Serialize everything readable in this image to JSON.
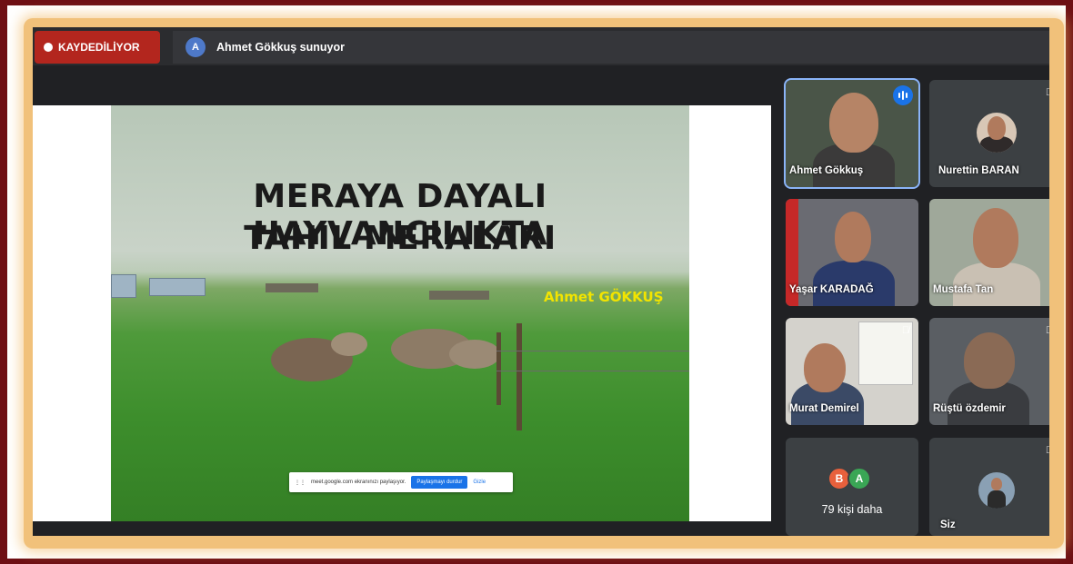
{
  "recording": {
    "label": "KAYDEDİLİYOR"
  },
  "presenter": {
    "avatar_letter": "A",
    "text": "Ahmet Gökkuş sunuyor"
  },
  "slide": {
    "title_line1": "MERAYA DAYALI HAYVANCILIKTA",
    "title_line2": "TAHIL MERALARI",
    "author": "Ahmet GÖKKUŞ"
  },
  "share_bar": {
    "message": "meet.google.com ekranınızı paylaşıyor.",
    "stop_label": "Paylaşmayı durdur",
    "hide_label": "Gizle"
  },
  "participants": [
    {
      "name": "Ahmet Gökkuş",
      "speaking": true
    },
    {
      "name": "Nurettin BARAN",
      "muted": true
    },
    {
      "name": "Yaşar KARADAĞ"
    },
    {
      "name": "Mustafa Tan"
    },
    {
      "name": "Murat Demirel",
      "muted": true
    },
    {
      "name": "Rüştü özdemir",
      "muted": true
    }
  ],
  "more": {
    "avatars": [
      {
        "letter": "B",
        "color": "#e8603c"
      },
      {
        "letter": "A",
        "color": "#3aa655"
      }
    ],
    "label": "79 kişi daha"
  },
  "self_tile": {
    "name": "Siz",
    "muted": true
  },
  "colors": {
    "record_red": "#b3261e",
    "accent_blue": "#1a73e8",
    "frame_gold": "#f1c17a",
    "outer_maroon": "#6e0f14"
  }
}
